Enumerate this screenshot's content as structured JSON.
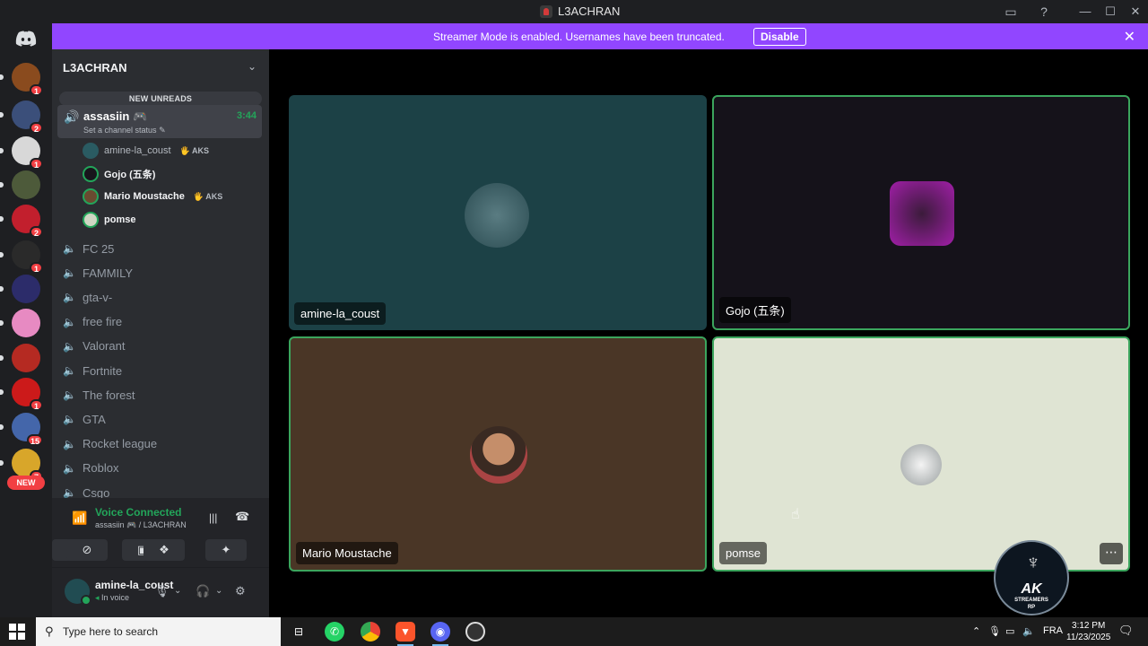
{
  "window": {
    "title": "L3ACHRAN"
  },
  "banner": {
    "message": "Streamer Mode is enabled. Usernames have been truncated.",
    "disable_label": "Disable",
    "color": "#9146ff"
  },
  "servers": [
    {
      "badge": "1",
      "color": "#8a4b1e"
    },
    {
      "badge": "2",
      "color": "#3b4f7a"
    },
    {
      "badge": "1",
      "color": "#d8d8d8"
    },
    {
      "badge": "",
      "color": "#4d5a3a"
    },
    {
      "badge": "2",
      "color": "#c21f2d"
    },
    {
      "badge": "1",
      "color": "#2a2a2a"
    },
    {
      "badge": "",
      "color": "#2c2c6a"
    },
    {
      "badge": "",
      "color": "#e78ac2"
    },
    {
      "badge": "",
      "color": "#b52a22"
    },
    {
      "badge": "1",
      "color": "#cc1a1a"
    },
    {
      "badge": "15",
      "color": "#4466aa"
    },
    {
      "badge": "7",
      "color": "#d8a62a"
    }
  ],
  "rail": {
    "new_label": "NEW"
  },
  "guild": {
    "name": "L3ACHRAN",
    "new_unreads": "NEW UNREADS"
  },
  "active_channel": {
    "name": "assasiin",
    "time": "3:44",
    "status": "Set a channel status"
  },
  "voice_users": [
    {
      "name": "amine-la_coust",
      "tag": "AKS",
      "speaking": false
    },
    {
      "name": "Gojo (五条)",
      "tag": "",
      "speaking": true
    },
    {
      "name": "Mario Moustache",
      "tag": "AKS",
      "speaking": true
    },
    {
      "name": "pomse",
      "tag": "",
      "speaking": true
    }
  ],
  "channels": [
    {
      "name": "FC 25"
    },
    {
      "name": "FAMMILY"
    },
    {
      "name": "gta-v-"
    },
    {
      "name": "free fire"
    },
    {
      "name": "Valorant"
    },
    {
      "name": "Fortnite"
    },
    {
      "name": "The forest"
    },
    {
      "name": "GTA"
    },
    {
      "name": "Rocket league"
    },
    {
      "name": "Roblox"
    },
    {
      "name": "Csgo"
    }
  ],
  "voice_panel": {
    "status": "Voice Connected",
    "location": "assasiin 🎮 / L3ACHRAN"
  },
  "user_panel": {
    "name": "amine-la_coust",
    "status": "In voice"
  },
  "tiles": [
    {
      "label": "amine-la_coust",
      "bg": "#1c4146",
      "speaking": false
    },
    {
      "label": "Gojo (五条)",
      "bg": "#15121a",
      "speaking": true
    },
    {
      "label": "Mario Moustache",
      "bg": "#4a3626",
      "speaking": true
    },
    {
      "label": "pomse",
      "bg": "#dfe4d3",
      "speaking": true
    }
  ],
  "watermark": {
    "main": "AK",
    "sub": "STREAMERS",
    "sub2": "RP"
  },
  "taskbar": {
    "search_placeholder": "Type here to search",
    "lang": "FRA",
    "time": "3:12 PM",
    "date": "11/23/2025"
  }
}
